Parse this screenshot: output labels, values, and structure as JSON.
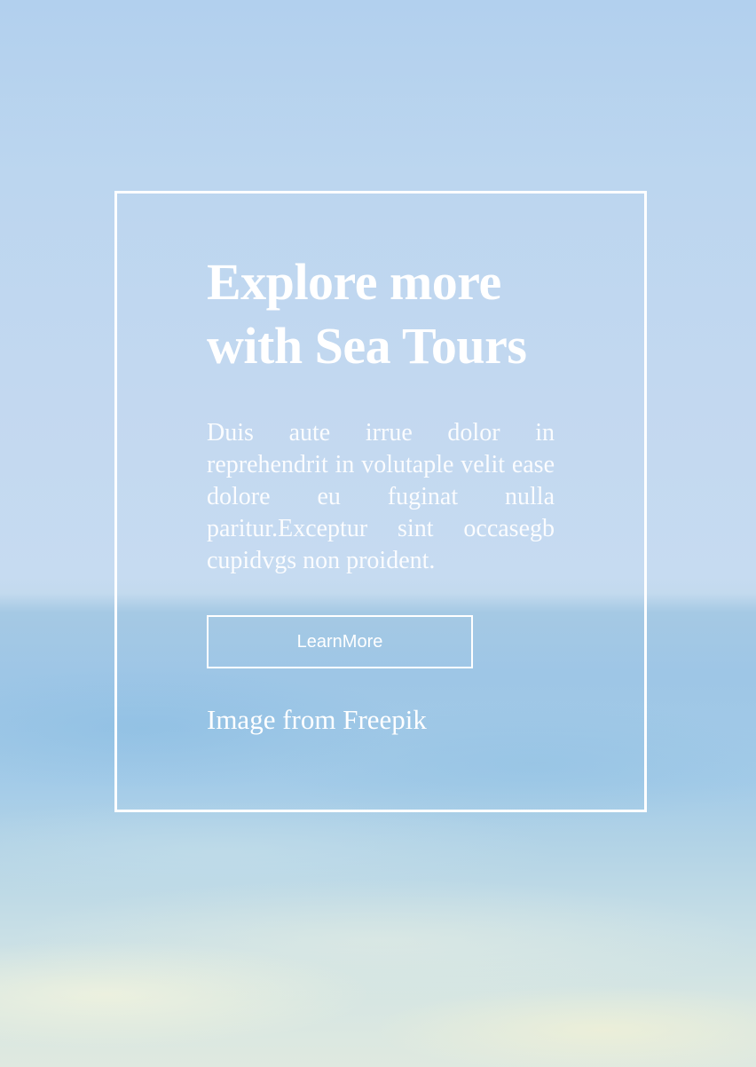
{
  "hero": {
    "title": "Explore more with Sea Tours",
    "description": "Duis aute irrue dolor in reprehendrit in volutaple velit ease dolore eu fuginat nulla paritur.Exceptur sint occasegb cupidvgs non proident.",
    "button_label": "LearnMore",
    "credit": "Image from Freepik"
  },
  "colors": {
    "text": "#ffffff",
    "frame_border": "#ffffff",
    "sky": "#b2d0ee",
    "sea": "#9ec6e6",
    "shore": "#dfe9e0"
  }
}
